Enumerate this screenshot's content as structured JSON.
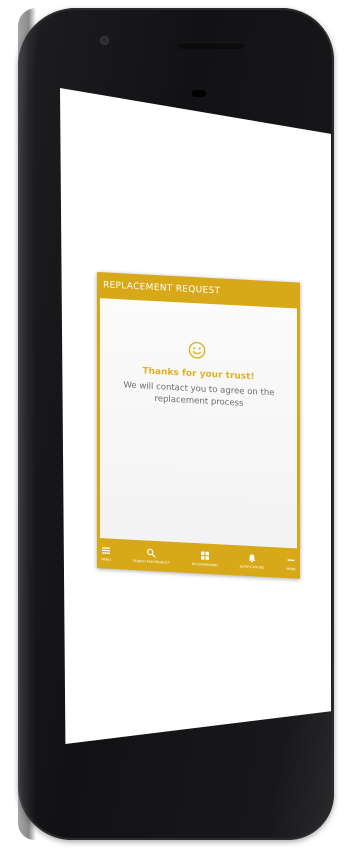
{
  "app": {
    "header_title": "REPLACEMENT REQUEST",
    "message_title": "Thanks for your trust!",
    "message_body": "We will contact you to agree on the replacement process"
  },
  "nav": [
    {
      "label": "Menu",
      "icon": "hamburger-icon"
    },
    {
      "label": "Search for Product",
      "icon": "search-icon"
    },
    {
      "label": "My Dashboard",
      "icon": "dashboard-icon"
    },
    {
      "label": "Notifications",
      "icon": "bell-icon"
    },
    {
      "label": "More",
      "icon": "more-icon"
    }
  ],
  "colors": {
    "accent": "#d7a817",
    "phone_body": "#151517",
    "screen_background": "#ffffff"
  }
}
